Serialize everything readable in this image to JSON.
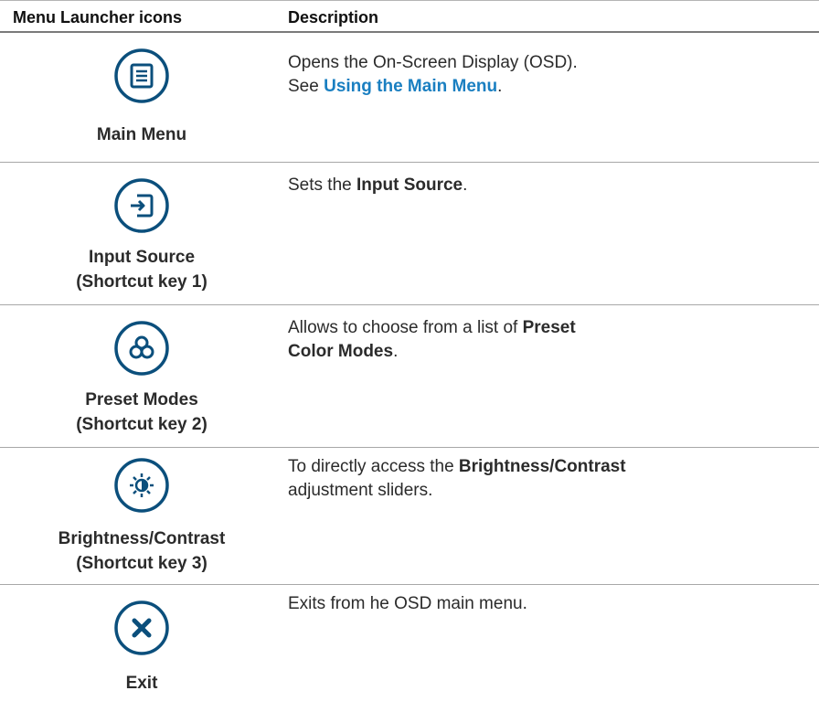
{
  "header": {
    "col1": "Menu Launcher icons",
    "col2": "Description"
  },
  "rows": [
    {
      "label_line1": "Main Menu",
      "label_line2": "",
      "icon": "main-menu-icon",
      "desc_text1": "Opens the On-Screen Display (OSD).",
      "desc_text2": "See ",
      "desc_link": "Using the Main Menu",
      "desc_text3": "."
    },
    {
      "label_line1": "Input Source",
      "label_line2": "(Shortcut key 1)",
      "icon": "input-source-icon",
      "desc_text1": "Sets the ",
      "desc_bold": "Input Source",
      "desc_text2": "."
    },
    {
      "label_line1": "Preset Modes",
      "label_line2": "(Shortcut key 2)",
      "icon": "preset-modes-icon",
      "desc_text1": "Allows to choose from a list of ",
      "desc_bold1": "Preset",
      "desc_bold2": "Color Modes",
      "desc_text2": "."
    },
    {
      "label_line1": "Brightness/Contrast",
      "label_line2": "(Shortcut key 3)",
      "icon": "brightness-contrast-icon",
      "desc_text1": "To directly access the ",
      "desc_bold": "Brightness/Contrast",
      "desc_text2": "adjustment sliders."
    },
    {
      "label_line1": "Exit",
      "label_line2": "",
      "icon": "exit-icon",
      "desc_text1": "Exits from he OSD main menu."
    }
  ],
  "colors": {
    "icon_blue": "#0b4f7c",
    "link_blue": "#1a7fc1",
    "rule_gray": "#a8a8a8"
  }
}
